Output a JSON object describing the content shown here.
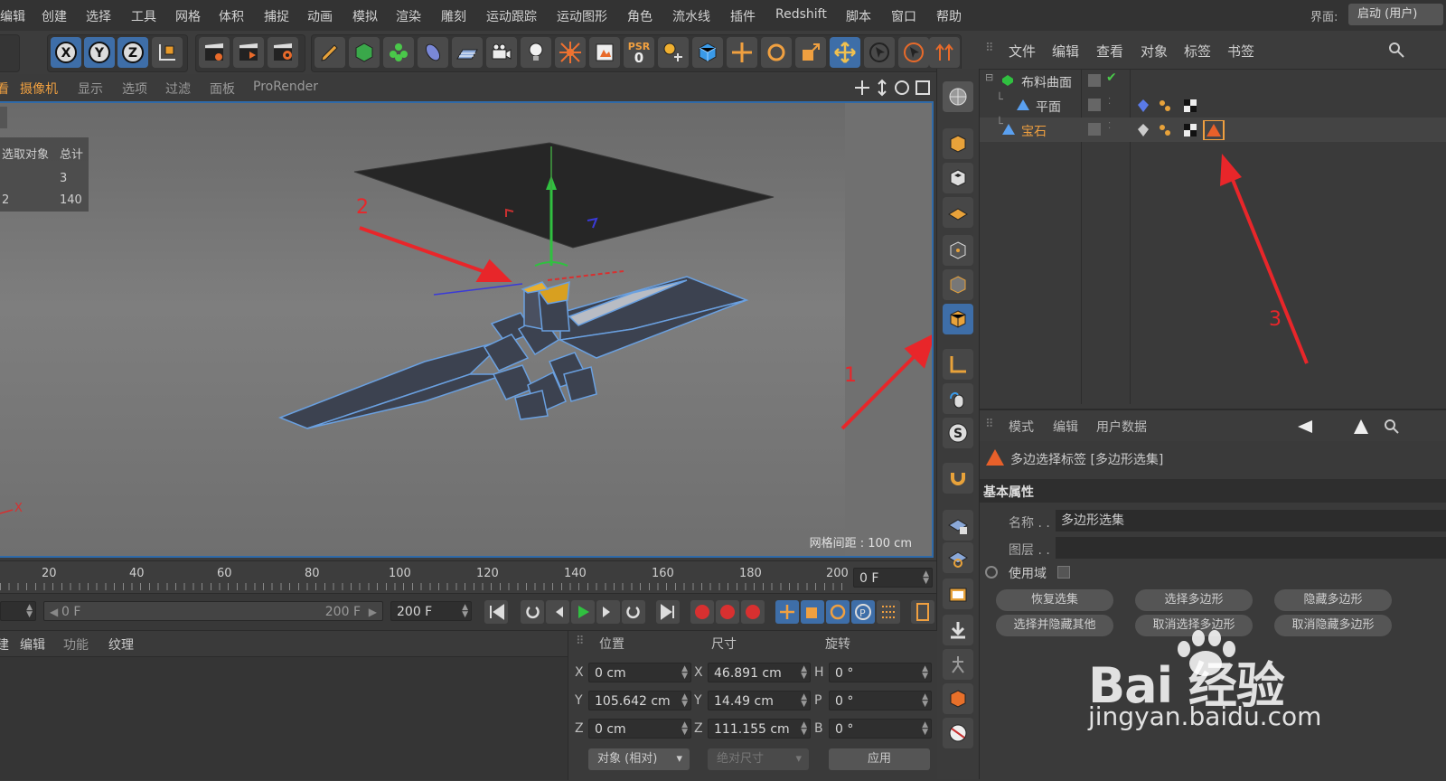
{
  "menu": [
    "编辑",
    "创建",
    "选择",
    "工具",
    "网格",
    "体积",
    "捕捉",
    "动画",
    "模拟",
    "渲染",
    "雕刻",
    "运动跟踪",
    "运动图形",
    "角色",
    "流水线",
    "插件",
    "Redshift",
    "脚本",
    "窗口",
    "帮助"
  ],
  "layout": {
    "label": "界面:",
    "value": "启动 (用户)"
  },
  "axis_lock": [
    "X",
    "Y",
    "Z"
  ],
  "psr": {
    "label": "PSR",
    "value": "0"
  },
  "viewport": {
    "menu": [
      "摄像机",
      "显示",
      "选项",
      "过滤",
      "面板",
      "ProRender"
    ],
    "stats": {
      "header": [
        "选取对象",
        "总计"
      ],
      "rows": [
        [
          "",
          "3"
        ],
        [
          "2",
          "140"
        ]
      ]
    },
    "grid_label": "网格间距 : 100 cm",
    "axis_label": "X",
    "annotations": [
      "1",
      "2",
      "3"
    ]
  },
  "object_manager": {
    "menu": [
      "文件",
      "编辑",
      "查看",
      "对象",
      "标签",
      "书签"
    ],
    "objects": [
      {
        "name": "布料曲面",
        "selected": false
      },
      {
        "name": "平面",
        "selected": false
      },
      {
        "name": "宝石",
        "selected": true
      }
    ]
  },
  "attribute_manager": {
    "menu": [
      "模式",
      "编辑",
      "用户数据"
    ],
    "title": "多边选择标签 [多边形选集]",
    "section": "基本属性",
    "name_label": "名称 . .",
    "name_value": "多边形选集",
    "layer_label": "图层 . .",
    "use_field_label": "使用域",
    "buttons": [
      "恢复选集",
      "选择多边形",
      "隐藏多边形",
      "选择并隐藏其他",
      "取消选择多边形",
      "取消隐藏多边形"
    ]
  },
  "timeline": {
    "ticks": [
      "20",
      "40",
      "60",
      "80",
      "100",
      "120",
      "140",
      "160",
      "180",
      "200"
    ],
    "current_frame": "0 F",
    "range_start": "0 F",
    "range_end": "200 F",
    "end_frame": "200 F"
  },
  "material": {
    "menu": [
      "编辑",
      "功能",
      "纹理"
    ]
  },
  "coordinates": {
    "headers": [
      "位置",
      "尺寸",
      "旋转"
    ],
    "rows": [
      {
        "axis": "X",
        "pos": "0 cm",
        "size_axis": "X",
        "size": "46.891 cm",
        "rot_axis": "H",
        "rot": "0 °"
      },
      {
        "axis": "Y",
        "pos": "105.642 cm",
        "size_axis": "Y",
        "size": "14.49 cm",
        "rot_axis": "P",
        "rot": "0 °"
      },
      {
        "axis": "Z",
        "pos": "0 cm",
        "size_axis": "Z",
        "size": "111.155 cm",
        "rot_axis": "B",
        "rot": "0 °"
      }
    ],
    "mode_select": "对象 (相对)",
    "size_select": "绝对尺寸",
    "apply_label": "应用"
  },
  "watermark": {
    "brand": "Bai 经验",
    "url": "jingyan.baidu.com"
  },
  "colors": {
    "accent_blue": "#3e6ea8",
    "selected_orange": "#f0a040",
    "annotation_red": "#e8262a"
  }
}
